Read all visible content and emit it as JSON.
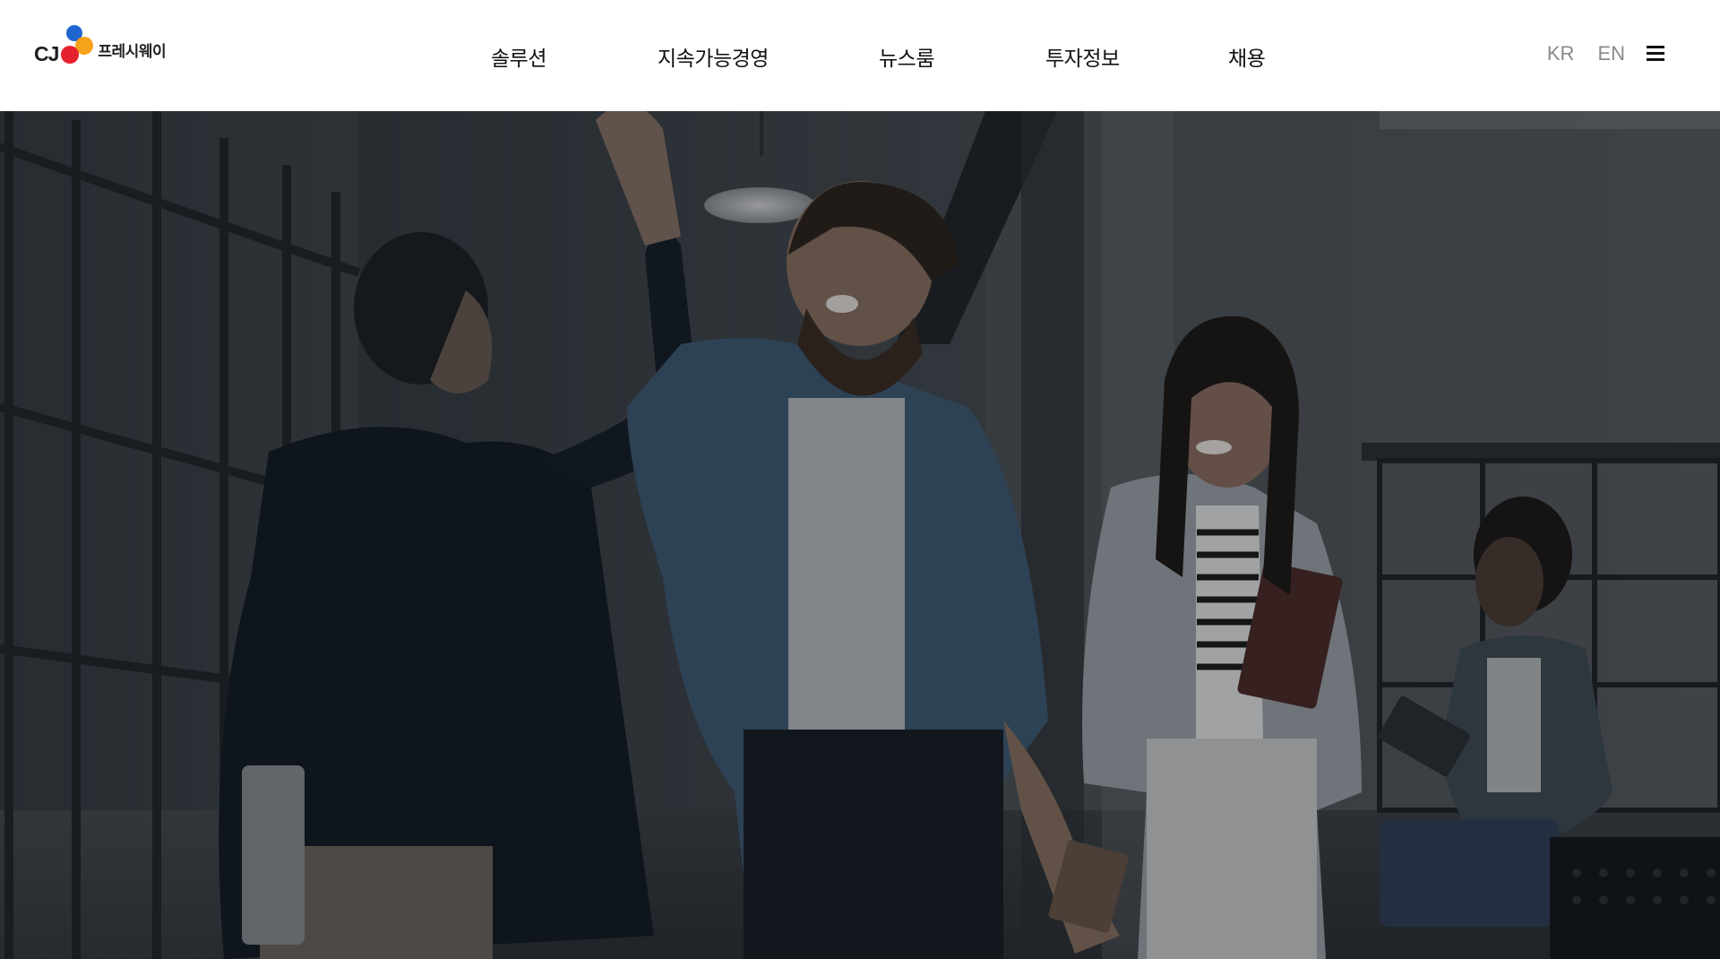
{
  "header": {
    "logo": {
      "brand": "CJ",
      "name": "프레시웨이",
      "icon": "cj-flower-logo-icon"
    },
    "nav": [
      {
        "label": "솔루션"
      },
      {
        "label": "지속가능경영"
      },
      {
        "label": "뉴스룸"
      },
      {
        "label": "투자정보"
      },
      {
        "label": "채용"
      }
    ],
    "languages": [
      "KR",
      "EN"
    ],
    "menu_icon": "hamburger-menu-icon"
  },
  "hero": {
    "image": "office-team-high-five-photo"
  },
  "colors": {
    "header_bg": "#ffffff",
    "nav_text": "#111111",
    "lang_text": "#8a8a8a",
    "logo_blue": "#1f66d1",
    "logo_red": "#e5212d",
    "logo_orange": "#f7a21b"
  }
}
